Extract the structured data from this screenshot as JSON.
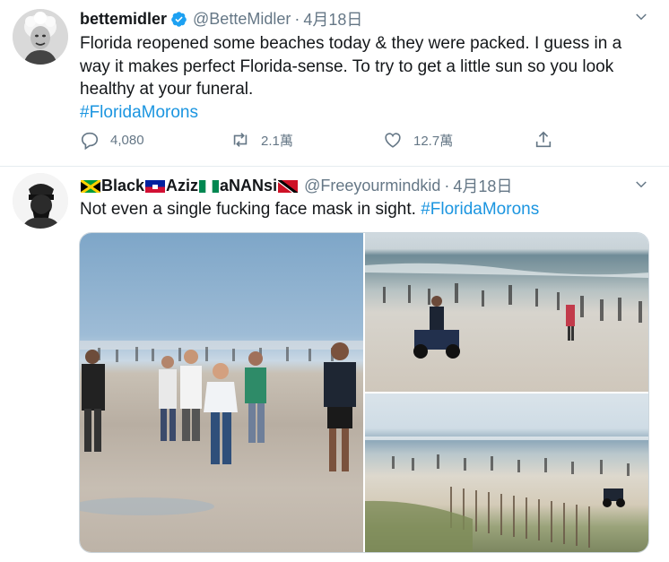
{
  "tweets": [
    {
      "name": "bettemidler",
      "handle": "@BetteMidler",
      "separator": "·",
      "date": "4月18日",
      "verified": true,
      "text_plain": "Florida reopened some beaches today & they were packed. I guess in a way it makes perfect Florida-sense. To try to get a little sun so you look healthy at your funeral.",
      "hashtag": "#FloridaMorons",
      "replies": "4,080",
      "retweets": "2.1萬",
      "likes": "12.7萬"
    },
    {
      "name_parts": [
        "Black",
        "Aziz",
        "aNANsi"
      ],
      "flags": [
        "jamaica-flag",
        "haiti-flag",
        "nigeria-flag",
        "trinidad-flag"
      ],
      "handle": "@Freeyourmindkid",
      "separator": "·",
      "date": "4月18日",
      "text_plain": "Not even a single fucking face mask in sight.",
      "hashtag": "#FloridaMorons",
      "media_count": 3
    }
  ],
  "icons": {
    "reply": "reply-icon",
    "retweet": "retweet-icon",
    "like": "heart-icon",
    "share": "share-icon",
    "caret": "chevron-down-icon",
    "verified": "verified-badge-icon"
  },
  "colors": {
    "link": "#1b95e0",
    "muted": "#657786",
    "text": "#14171a",
    "verified": "#1da1f2"
  }
}
